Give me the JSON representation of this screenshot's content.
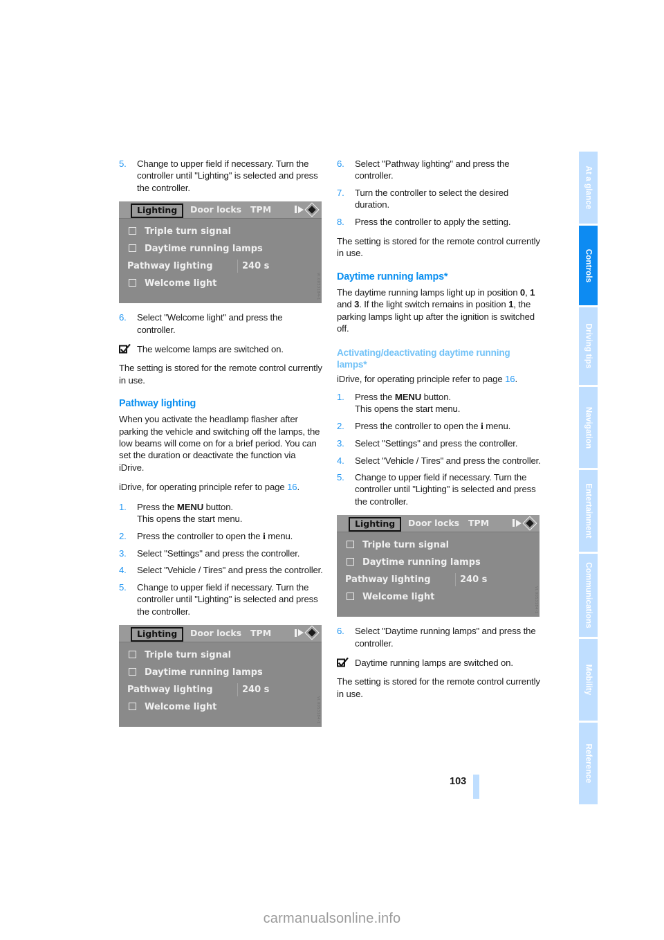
{
  "page": {
    "number": "103",
    "watermark": "carmanualsonline.info"
  },
  "colors": {
    "heading_blue": "#0a8ff0",
    "subheading_blue": "#72c2f7",
    "step_number_blue": "#2196f3",
    "rail_inactive": "#bfdeff",
    "rail_active": "#0d8bf2",
    "idrive_bg": "#8a8a8a"
  },
  "rail": {
    "tabs": [
      {
        "label": "At a glance",
        "active": false
      },
      {
        "label": "Controls",
        "active": true
      },
      {
        "label": "Driving tips",
        "active": false
      },
      {
        "label": "Navigation",
        "active": false
      },
      {
        "label": "Entertainment",
        "active": false
      },
      {
        "label": "Communications",
        "active": false
      },
      {
        "label": "Mobility",
        "active": false
      },
      {
        "label": "Reference",
        "active": false
      }
    ]
  },
  "idrive_screen": {
    "tab_selected": "Lighting",
    "tab_2": "Door locks",
    "tab_3": "TPM",
    "rows": [
      {
        "label": "Triple turn signal",
        "checkbox": true,
        "value": ""
      },
      {
        "label": "Daytime running lamps",
        "checkbox": true,
        "value": ""
      },
      {
        "label": "Pathway lighting",
        "checkbox": false,
        "value": "240 s"
      },
      {
        "label": "Welcome light",
        "checkbox": true,
        "value": ""
      }
    ],
    "code": "VI.0053184-1"
  },
  "left_column": {
    "step5a": {
      "num": "5.",
      "text": "Change to upper field if necessary. Turn the controller until \"Lighting\" is selected and press the controller."
    },
    "step6": {
      "num": "6.",
      "text": "Select \"Welcome light\" and press the controller."
    },
    "result6": "The welcome lamps are switched on.",
    "stored_note": "The setting is stored for the remote control currently in use.",
    "pathway_heading": "Pathway lighting",
    "pathway_body": "When you activate the headlamp flasher after parking the vehicle and switching off the lamps, the low beams will come on for a brief period. You can set the duration or deactivate the function via iDrive.",
    "idrive_ref_pre": "iDrive, for operating principle refer to page ",
    "idrive_ref_page": "16",
    "idrive_ref_post": ".",
    "steps": [
      {
        "num": "1.",
        "text": "Press the ",
        "bold": "MENU",
        "after": " button.",
        "sub": "This opens the start menu."
      },
      {
        "num": "2.",
        "text": "Press the controller to open the ",
        "icon": "i",
        "after": " menu.",
        "sub": ""
      },
      {
        "num": "3.",
        "text": "Select \"Settings\" and press the controller.",
        "sub": ""
      },
      {
        "num": "4.",
        "text": "Select \"Vehicle / Tires\" and press the controller.",
        "sub": ""
      },
      {
        "num": "5.",
        "text": "Change to upper field if necessary. Turn the controller until \"Lighting\" is selected and press the controller.",
        "sub": ""
      }
    ]
  },
  "right_column": {
    "step6": {
      "num": "6.",
      "text": "Select \"Pathway lighting\" and press the controller."
    },
    "step7": {
      "num": "7.",
      "text": "Turn the controller to select the desired duration."
    },
    "step8": {
      "num": "8.",
      "text": "Press the controller to apply the setting."
    },
    "stored_note_top": "The setting is stored for the remote control currently in use.",
    "drl_heading": "Daytime running lamps*",
    "drl_body_1": "The daytime running lamps light up in position ",
    "drl_pos_0": "0",
    "drl_body_2": ", ",
    "drl_pos_1": "1",
    "drl_body_3": " and ",
    "drl_pos_3": "3",
    "drl_body_4": ". If the light switch remains in position ",
    "drl_pos_1b": "1",
    "drl_body_5": ", the parking lamps light up after the ignition is switched off.",
    "activ_heading": "Activating/deactivating daytime running lamps*",
    "idrive_ref_pre": "iDrive, for operating principle refer to page ",
    "idrive_ref_page": "16",
    "idrive_ref_post": ".",
    "steps": [
      {
        "num": "1.",
        "text": "Press the ",
        "bold": "MENU",
        "after": " button.",
        "sub": "This opens the start menu."
      },
      {
        "num": "2.",
        "text": "Press the controller to open the ",
        "icon": "i",
        "after": " menu.",
        "sub": ""
      },
      {
        "num": "3.",
        "text": "Select \"Settings\" and press the controller.",
        "sub": ""
      },
      {
        "num": "4.",
        "text": "Select \"Vehicle / Tires\" and press the controller.",
        "sub": ""
      },
      {
        "num": "5.",
        "text": "Change to upper field if necessary. Turn the controller until \"Lighting\" is selected and press the controller.",
        "sub": ""
      }
    ],
    "step6b": {
      "num": "6.",
      "text": "Select \"Daytime running lamps\" and press the controller."
    },
    "result6b": "Daytime running lamps are switched on.",
    "stored_note_bottom": "The setting is stored for the remote control currently in use."
  }
}
